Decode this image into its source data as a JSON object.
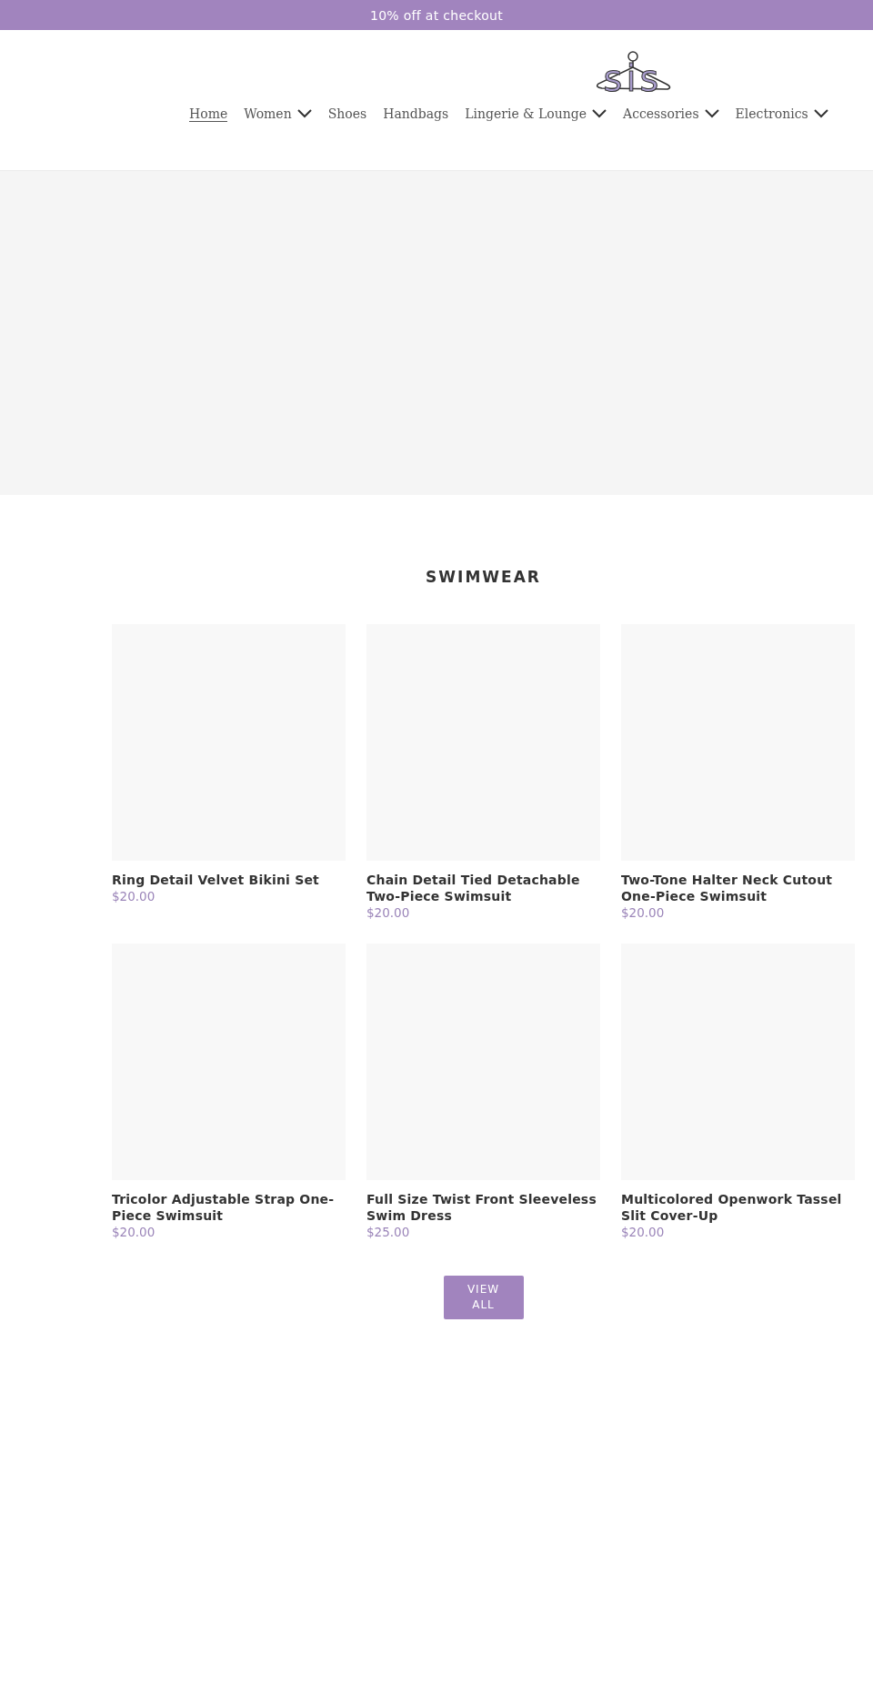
{
  "announcement": "10% off at checkout",
  "logo": {
    "text": "sis"
  },
  "nav": [
    {
      "label": "Home",
      "selected": true,
      "dropdown": false
    },
    {
      "label": "Women",
      "selected": false,
      "dropdown": true
    },
    {
      "label": "Shoes",
      "selected": false,
      "dropdown": false
    },
    {
      "label": "Handbags",
      "selected": false,
      "dropdown": false
    },
    {
      "label": "Lingerie & Lounge",
      "selected": false,
      "dropdown": true
    },
    {
      "label": "Accessories",
      "selected": false,
      "dropdown": true
    },
    {
      "label": "Electronics",
      "selected": false,
      "dropdown": true
    }
  ],
  "collection": {
    "title": "SWIMWEAR",
    "products": [
      {
        "name": "Ring Detail Velvet Bikini Set",
        "price": "$20.00"
      },
      {
        "name": "Chain Detail Tied Detachable Two-Piece Swimsuit",
        "price": "$20.00"
      },
      {
        "name": "Two-Tone Halter Neck Cutout One-Piece Swimsuit",
        "price": "$20.00"
      },
      {
        "name": "Tricolor Adjustable Strap One-Piece Swimsuit",
        "price": "$20.00"
      },
      {
        "name": "Full Size Twist Front Sleeveless Swim Dress",
        "price": "$25.00"
      },
      {
        "name": "Multicolored Openwork Tassel Slit Cover-Up",
        "price": "$20.00"
      }
    ],
    "button": "VIEW ALL"
  }
}
